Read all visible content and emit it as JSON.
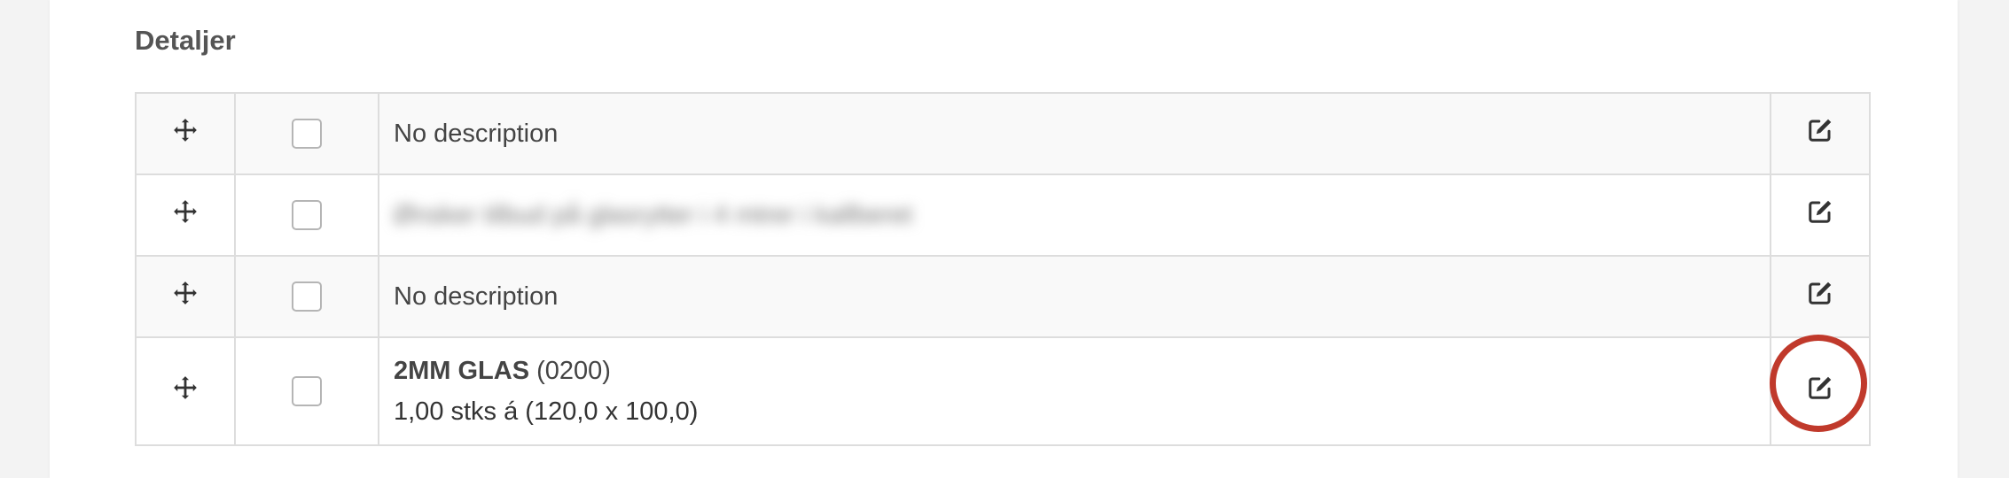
{
  "section": {
    "title": "Detaljer"
  },
  "rows": [
    {
      "description": "No description"
    },
    {
      "description": "Ønsker tilbud på glasrytter i 4 mtrer i kallberet"
    },
    {
      "description": "No description"
    },
    {
      "product_name": "2MM GLAS",
      "product_code": "(0200)",
      "quantity_line": "1,00 stks á (120,0 x 100,0)"
    }
  ],
  "icons": {
    "move": "move-arrows-icon",
    "edit": "edit-square-pen-icon"
  },
  "colors": {
    "highlight_ring": "#c0392b",
    "border": "#dddddd",
    "row_alt": "#f9f9f9"
  }
}
